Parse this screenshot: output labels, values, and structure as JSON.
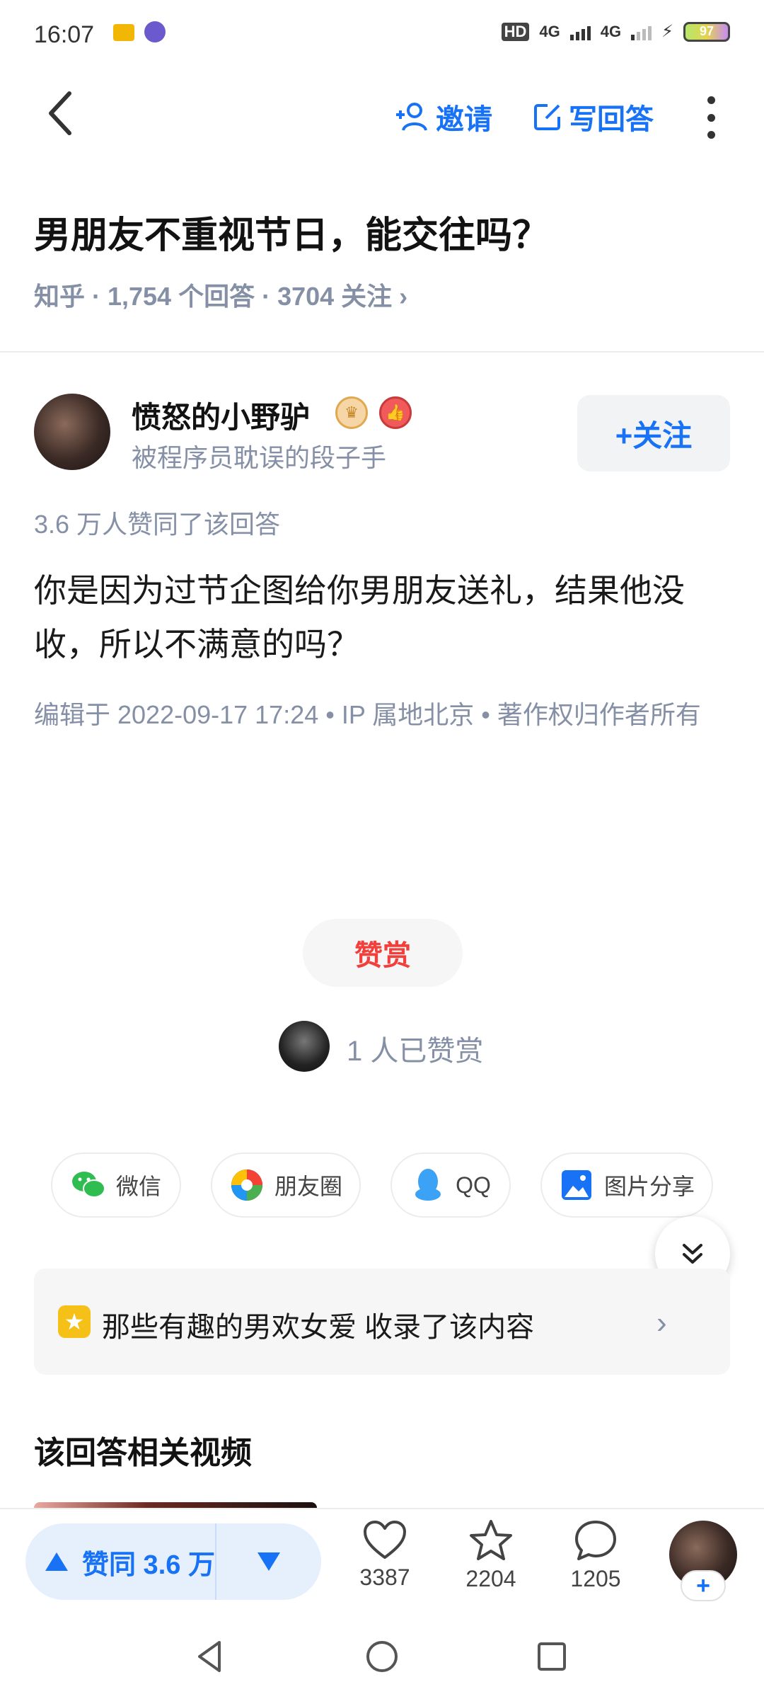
{
  "status": {
    "time": "16:07",
    "network1": "4G",
    "network2": "4G",
    "hd": "HD",
    "battery": "97"
  },
  "nav": {
    "invite": "邀请",
    "write_answer": "写回答"
  },
  "question": {
    "title": "男朋友不重视节日，能交往吗？",
    "meta": "知乎 · 1,754 个回答 · 3704 关注 ›"
  },
  "author": {
    "name": "愤怒的小野驴",
    "description": "被程序员耽误的段子手",
    "follow_label": "+关注"
  },
  "answer": {
    "agree_summary": "3.6 万人赞同了该回答",
    "content": "你是因为过节企图给你男朋友送礼，结果他没收，所以不满意的吗？",
    "edit_info": "编辑于 2022-09-17 17:24 • IP 属地北京 • 著作权归作者所有"
  },
  "reward": {
    "button": "赞赏",
    "count_text": "1 人已赞赏"
  },
  "share": [
    {
      "label": "微信",
      "icon": "wechat-icon"
    },
    {
      "label": "朋友圈",
      "icon": "moments-icon"
    },
    {
      "label": "QQ",
      "icon": "qq-icon"
    },
    {
      "label": "图片分享",
      "icon": "image-share-icon"
    }
  ],
  "collection": {
    "text": "那些有趣的男欢女爱 收录了该内容"
  },
  "related": {
    "title": "该回答相关视频"
  },
  "bottom": {
    "upvote_label": "赞同 3.6 万",
    "likes": "3387",
    "favorites": "2204",
    "comments": "1205",
    "plus": "+"
  },
  "colors": {
    "accent": "#1772f6",
    "reward": "#f1403c",
    "muted": "#8590a6"
  }
}
